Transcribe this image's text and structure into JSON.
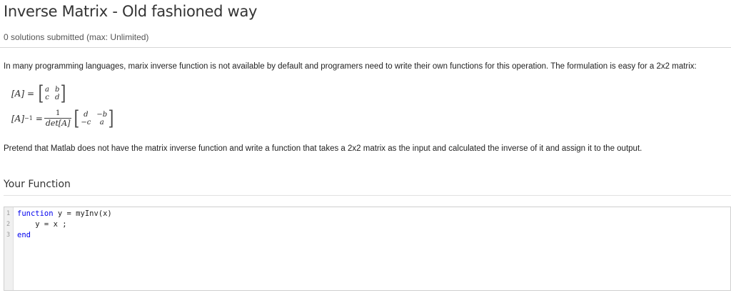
{
  "header": {
    "title": "Inverse Matrix - Old fashioned way",
    "submissions": "0 solutions submitted (max: Unlimited)"
  },
  "problem": {
    "intro": "In many programming languages, marix inverse function is not available by default and programers need to write their own functions for this operation. The formulation is easy for a 2x2 matrix:",
    "eq1": {
      "lhs": "[A]",
      "eq": "=",
      "a": "a",
      "b": "b",
      "c": "c",
      "d": "d"
    },
    "eq2": {
      "lhs": "[A]",
      "exp": "−1",
      "eq": "=",
      "num": "1",
      "den": "det[A]",
      "m11": "d",
      "m12": "−b",
      "m21": "−c",
      "m22": "a"
    },
    "task": "Pretend that Matlab does not have the matrix inverse function and write a function that takes a 2x2 matrix as the input and calculated the inverse of it and assign it to the output."
  },
  "your_function": {
    "title": "Your Function",
    "lines": [
      {
        "num": "1",
        "kw": "function",
        "rest": " y = myInv(x)"
      },
      {
        "num": "2",
        "kw": "",
        "rest": "    y = x ;"
      },
      {
        "num": "3",
        "kw": "end",
        "rest": ""
      }
    ]
  }
}
